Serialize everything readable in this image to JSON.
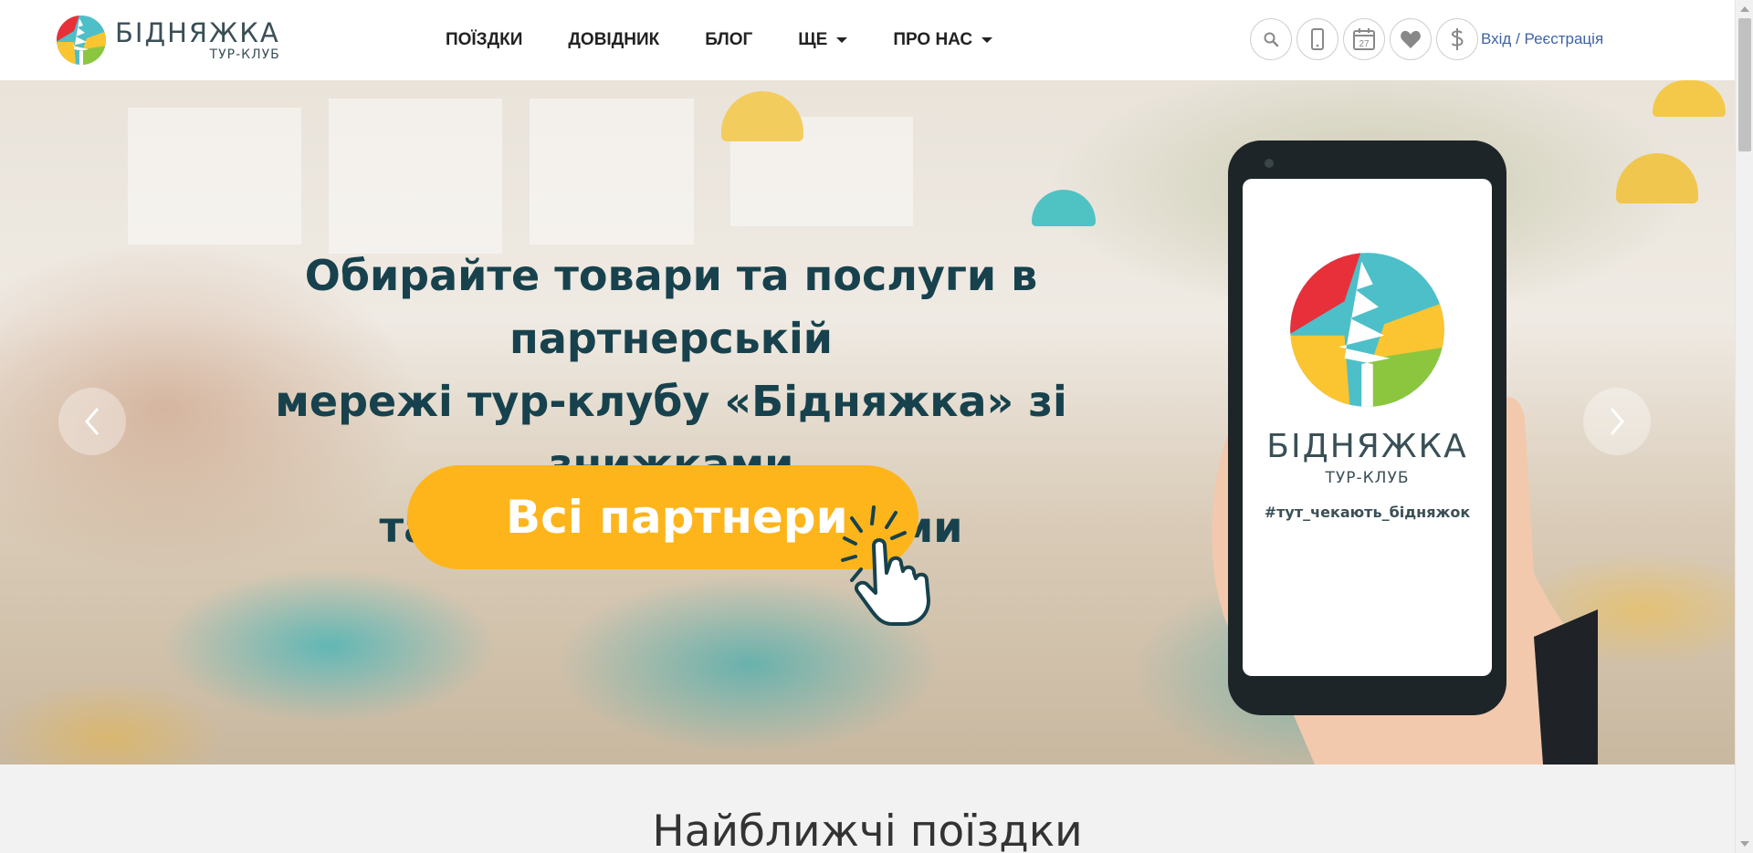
{
  "brand": {
    "name": "БІДНЯЖКА",
    "subtitle": "ТУР-КЛУБ",
    "colors": {
      "red": "#e8303a",
      "teal": "#4dbfc9",
      "yellow": "#fbc531",
      "green": "#8cc63f",
      "dark": "#3a4f56"
    }
  },
  "nav": {
    "items": [
      {
        "label": "ПОЇЗДКИ",
        "dropdown": false
      },
      {
        "label": "ДОВІДНИК",
        "dropdown": false
      },
      {
        "label": "БЛОГ",
        "dropdown": false
      },
      {
        "label": "ЩЕ",
        "dropdown": true
      },
      {
        "label": "ПРО НАС",
        "dropdown": true
      }
    ]
  },
  "tools": {
    "icons": [
      "search-icon",
      "mobile-phone-icon",
      "calendar-icon",
      "heart-icon",
      "dollar-icon"
    ],
    "calendar_day": "27",
    "login_label": "Вхід / Реєстрація"
  },
  "hero": {
    "headline_lines": [
      "Обирайте товари та послуги в партнерській",
      "мережі тур-клубу «Бідняжка» зі знижками",
      "та приємними бонусами"
    ],
    "cta_label": "Всі партнери",
    "cta_color": "#fdb51b",
    "headline_color": "#17424d",
    "phone": {
      "name": "БІДНЯЖКА",
      "subtitle": "ТУР-КЛУБ",
      "hashtag": "#тут_чекають_бідняжок"
    }
  },
  "section": {
    "title": "Найближчі поїздки"
  },
  "accent_link_color": "#3d63a3"
}
